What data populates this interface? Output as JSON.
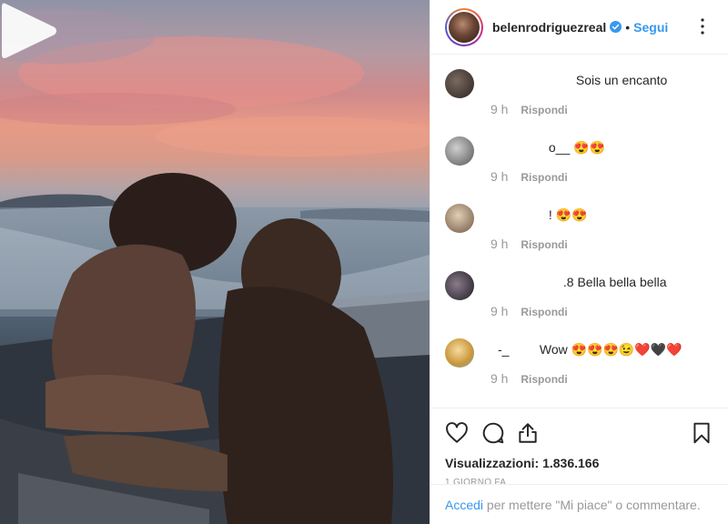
{
  "header": {
    "username": "belenrodriguezreal",
    "separator": "•",
    "follow_label": "Segui"
  },
  "comments": [
    {
      "name": "",
      "text": "Sois un encanto",
      "time": "9 h",
      "reply_label": "Rispondi",
      "avatar_color": "#3a3230"
    },
    {
      "name": "",
      "text": "o__ 😍😍",
      "time": "9 h",
      "reply_label": "Rispondi",
      "avatar_color": "#8a8a8a"
    },
    {
      "name": "",
      "text": "! 😍😍",
      "time": "9 h",
      "reply_label": "Rispondi",
      "avatar_color": "#b59a7c"
    },
    {
      "name": "",
      "text": ".8 Bella bella bella",
      "time": "9 h",
      "reply_label": "Rispondi",
      "avatar_color": "#3b3340"
    },
    {
      "name": "-_",
      "text": "Wow 😍😍😍😉❤️🖤❤️",
      "time": "9 h",
      "reply_label": "Rispondi",
      "avatar_color": "#e8c070"
    }
  ],
  "stats": {
    "views_label": "Visualizzazioni: 1.836.166",
    "timestamp": "1 GIORNO FA"
  },
  "footer": {
    "login_link": "Accedi",
    "login_text": " per mettere \"Mi piace\" o commentare."
  },
  "colors": {
    "accent": "#3897f0",
    "secondary_text": "#999999",
    "border": "#efefef"
  },
  "icons": [
    "play-icon",
    "verified-icon",
    "more-options-icon",
    "heart-icon",
    "comment-icon",
    "share-icon",
    "bookmark-icon"
  ]
}
